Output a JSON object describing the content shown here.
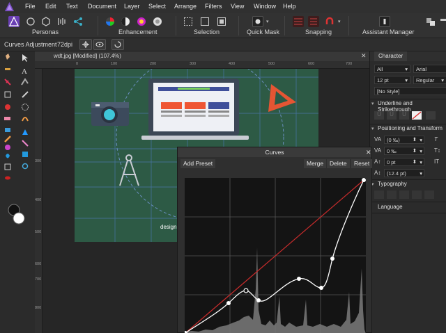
{
  "menu": [
    "File",
    "Edit",
    "Text",
    "Document",
    "Layer",
    "Select",
    "Arrange",
    "Filters",
    "View",
    "Window",
    "Help"
  ],
  "toolbar": {
    "personas_label": "Personas",
    "enhancement_label": "Enhancement",
    "selection_label": "Selection",
    "quickmask_label": "Quick Mask",
    "snapping_label": "Snapping",
    "assistant_label": "Assistant Manager"
  },
  "context": {
    "tool_name": "Curves Adjustment",
    "dpi": "72dpi"
  },
  "document": {
    "tab_title": "wdt.jpg [Modified] (107.4%)",
    "ruler_top_ticks": [
      "0",
      "100",
      "200",
      "300",
      "400",
      "500",
      "600",
      "700"
    ],
    "ruler_left_ticks": [
      "300",
      "400",
      "500",
      "600",
      "700",
      "800"
    ],
    "watermark": "designe"
  },
  "panel": {
    "tab_character": "Character",
    "font_scope": "All",
    "font_family": "Arial",
    "font_size": "12 pt",
    "font_style": "Regular",
    "style_name": "[No Style]",
    "section_underline": "Underline and Strikethrough",
    "section_position": "Positioning and Transform",
    "kerning": "(0 ‰)",
    "tracking": "0 ‰",
    "baseline": "0 pt",
    "leading": "(12.4 pt)",
    "section_typography": "Typography",
    "section_language": "Language"
  },
  "curves": {
    "title": "Curves",
    "add_preset": "Add Preset",
    "merge": "Merge",
    "delete": "Delete",
    "reset": "Reset"
  },
  "colors": {
    "accent": "#7a4fc4",
    "artboard": "#2d5a45",
    "grid_blue": "#4f79b8",
    "curve_red": "#c42b2b"
  }
}
